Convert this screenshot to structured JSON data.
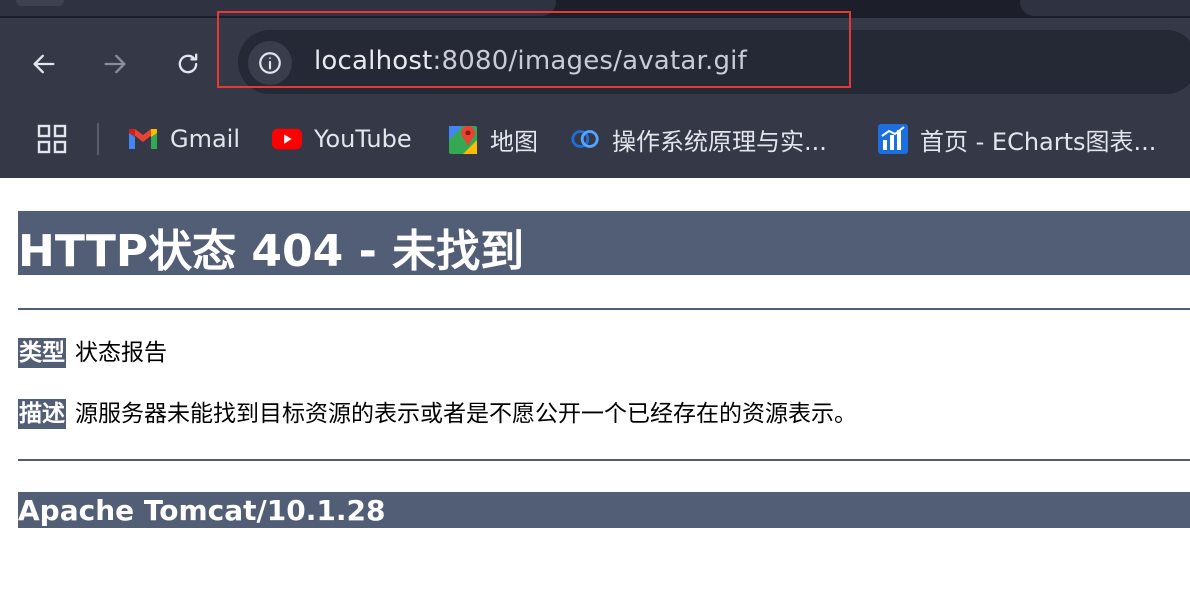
{
  "browser": {
    "nav": {
      "back_icon": "arrow-left-icon",
      "forward_icon": "arrow-right-icon",
      "reload_icon": "reload-icon"
    },
    "address_bar": {
      "host": "localhost",
      "rest": ":8080/images/avatar.gif",
      "site_info_icon": "info-icon"
    },
    "bookmarks": [
      {
        "label": "Gmail",
        "icon": "gmail-icon"
      },
      {
        "label": "YouTube",
        "icon": "youtube-icon"
      },
      {
        "label": "地图",
        "icon": "maps-icon"
      },
      {
        "label": "操作系统原理与实...",
        "icon": "course-icon"
      },
      {
        "label": "首页 - ECharts图表...",
        "icon": "echarts-icon"
      }
    ],
    "highlight_color": "#e53935"
  },
  "page": {
    "title": "HTTP状态 404 - 未找到",
    "type_label": "类型",
    "type_value": "状态报告",
    "description_label": "描述",
    "description_value": "源服务器未能找到目标资源的表示或者是不愿公开一个已经存在的资源表示。",
    "footer": "Apache Tomcat/10.1.28",
    "accent_color": "#525d76"
  }
}
